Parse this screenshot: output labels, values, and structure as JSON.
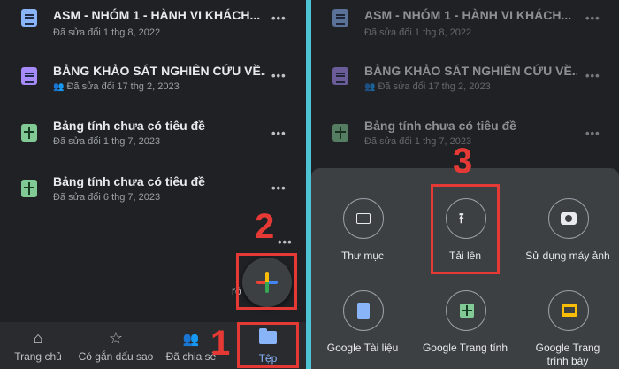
{
  "files": [
    {
      "title": "ASM - NHÓM 1 - HÀNH VI KHÁCH...",
      "meta": "Đã sửa đổi 1 thg 8, 2022",
      "icon": "doc-icon",
      "shared": false
    },
    {
      "title": "BẢNG KHẢO SÁT NGHIÊN CỨU VỀ...",
      "meta": "Đã sửa đổi 17 thg 2, 2023",
      "icon": "form-icon",
      "shared": true
    },
    {
      "title": "Bảng tính chưa có tiêu đề",
      "meta": "Đã sửa đổi 1 thg 7, 2023",
      "icon": "sheet-icon",
      "shared": false
    },
    {
      "title": "Bảng tính chưa có tiêu đề",
      "meta": "Đã sửa đổi 6 thg 7, 2023",
      "icon": "sheet-icon",
      "shared": false
    }
  ],
  "more_glyph": "•••",
  "people_glyph": "👥",
  "partial_label": "ró",
  "steps": [
    "1",
    "2",
    "3"
  ],
  "nav": {
    "home": "Trang chủ",
    "starred": "Có gắn dấu sao",
    "shared": "Đã chia sẻ",
    "files": "Tệp"
  },
  "nav_icons": {
    "home": "⌂",
    "starred": "☆",
    "shared": "👥"
  },
  "create_options": {
    "folder": "Thư mục",
    "upload": "Tải lên",
    "camera": "Sử dụng máy ảnh",
    "docs": "Google Tài liệu",
    "sheets": "Google Trang tính",
    "slides": "Google Trang trình bày"
  },
  "upload_glyph": "⭱",
  "colors": {
    "accent": "#8ab4f8",
    "highlight": "#e53935",
    "background": "#202124",
    "divider": "#4fc3d6"
  }
}
